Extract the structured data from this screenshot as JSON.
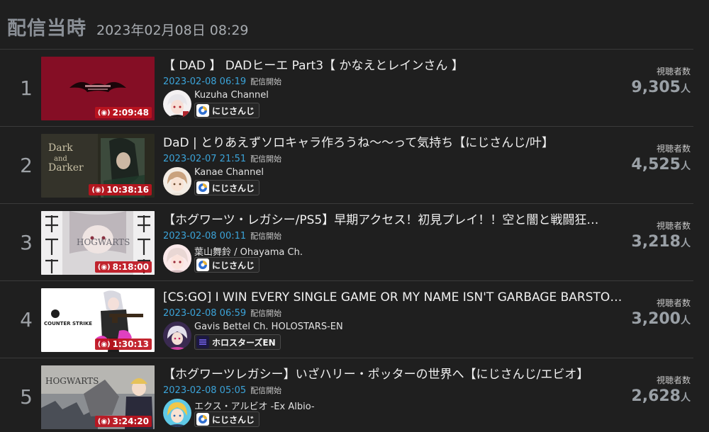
{
  "header": {
    "title": "配信当時",
    "timestamp": "2023年02月08日 08:29"
  },
  "labels": {
    "started_suffix": "配信開始",
    "viewers_label": "視聴者数",
    "viewers_unit": "人",
    "live_icon": "(◉)"
  },
  "rows": [
    {
      "rank": "1",
      "title": "【 DAD 】 DADヒーエ Part3【 かなえとレインさん 】",
      "date": "2023-02-08 06:19",
      "channel": "Kuzuha Channel",
      "agency": "にじさんじ",
      "duration": "2:09:48",
      "viewers": "9,305"
    },
    {
      "rank": "2",
      "title": "DaD | とりあえずソロキャラ作ろうね〜〜って気持ち【にじさんじ/叶】",
      "date": "2023-02-07 21:51",
      "channel": "Kanae Channel",
      "agency": "にじさんじ",
      "duration": "10:38:16",
      "viewers": "4,525",
      "thumb_text": [
        "Dark",
        "and",
        "Darker"
      ]
    },
    {
      "rank": "3",
      "title": "【ホグワーツ・レガシー/PS5】早期アクセス！初見プレイ！！空と闇と戦闘狂…",
      "date": "2023-02-08 00:11",
      "channel": "葉山舞鈴 / Ohayama Ch.",
      "agency": "にじさんじ",
      "duration": "8:18:00",
      "viewers": "3,218",
      "thumb_text": [
        "HOGWARTS"
      ]
    },
    {
      "rank": "4",
      "title": "[CS:GO] I WIN EVERY SINGLE GAME OR MY NAME ISN'T GARBAGE BARSTOOL…",
      "date": "2023-02-08 06:59",
      "channel": "Gavis Bettel Ch. HOLOSTARS-EN",
      "agency": "ホロスターズEN",
      "duration": "1:30:13",
      "viewers": "3,200",
      "thumb_text": [
        "COUNTER STRIKE"
      ]
    },
    {
      "rank": "5",
      "title": "【ホグワーツレガシー】いざハリー・ポッターの世界へ【にじさんじ/エビオ】",
      "date": "2023-02-08 05:05",
      "channel": "エクス・アルビオ -Ex Albio-",
      "agency": "にじさんじ",
      "duration": "3:24:20",
      "viewers": "2,628",
      "thumb_text": [
        "HOGWARTS"
      ]
    }
  ],
  "colors": {
    "background": "#1f1f1f",
    "date_blue": "#3ba3d8",
    "duration_red": "#be141e",
    "nijisanji_blue": "#2f6fd1",
    "holostars_purple": "#3a2a8a"
  },
  "icons": {
    "live": "broadcast-icon",
    "nijisanji": "nijisanji-logo-icon",
    "holostars": "holostars-logo-icon"
  }
}
